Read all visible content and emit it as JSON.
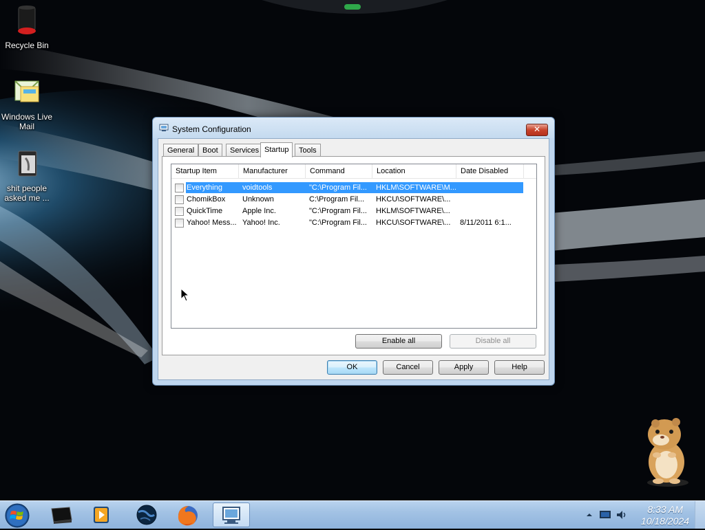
{
  "desktop": {
    "icons": [
      {
        "label": "Recycle Bin",
        "icon": "recycle-bin-icon"
      },
      {
        "label": "Windows Live Mail",
        "icon": "mail-icon"
      },
      {
        "label": "shit people asked me ...",
        "icon": "folder-icon"
      }
    ]
  },
  "dialog": {
    "title": "System Configuration",
    "close_label": "✕",
    "tabs": [
      {
        "label": "General",
        "active": false
      },
      {
        "label": "Boot",
        "active": false
      },
      {
        "label": "Services",
        "active": false
      },
      {
        "label": "Startup",
        "active": true
      },
      {
        "label": "Tools",
        "active": false
      }
    ],
    "columns": [
      "Startup Item",
      "Manufacturer",
      "Command",
      "Location",
      "Date Disabled"
    ],
    "rows": [
      {
        "item": "Everything",
        "manufacturer": "voidtools",
        "command": "\"C:\\Program Fil...",
        "location": "HKLM\\SOFTWARE\\M...",
        "date_disabled": "",
        "checked": false,
        "selected": true
      },
      {
        "item": "ChomikBox",
        "manufacturer": "Unknown",
        "command": "C:\\Program Fil...",
        "location": "HKCU\\SOFTWARE\\...",
        "date_disabled": "",
        "checked": false,
        "selected": false
      },
      {
        "item": "QuickTime",
        "manufacturer": "Apple Inc.",
        "command": "\"C:\\Program Fil...",
        "location": "HKLM\\SOFTWARE\\...",
        "date_disabled": "",
        "checked": false,
        "selected": false
      },
      {
        "item": "Yahoo! Mess...",
        "manufacturer": "Yahoo! Inc.",
        "command": "\"C:\\Program Fil...",
        "location": "HKCU\\SOFTWARE\\...",
        "date_disabled": "8/11/2011 6:1...",
        "checked": false,
        "selected": false
      }
    ],
    "enable_all_label": "Enable all",
    "disable_all_label": "Disable all",
    "ok_label": "OK",
    "cancel_label": "Cancel",
    "apply_label": "Apply",
    "help_label": "Help"
  },
  "taskbar": {
    "pinned": [
      {
        "name": "taskbar-app-console",
        "icon": "black-box-icon"
      },
      {
        "name": "taskbar-app-media-player",
        "icon": "media-player-icon"
      },
      {
        "name": "taskbar-app-globe",
        "icon": "globe-icon"
      },
      {
        "name": "taskbar-app-firefox",
        "icon": "firefox-icon"
      },
      {
        "name": "taskbar-app-msconfig",
        "icon": "system-config-icon",
        "active": true
      }
    ],
    "clock_time": "8:33 AM",
    "clock_date": "10/18/2024"
  },
  "colors": {
    "selection": "#3399ff",
    "taskbar": "#a2c2e4",
    "close_button": "#c8432c"
  }
}
